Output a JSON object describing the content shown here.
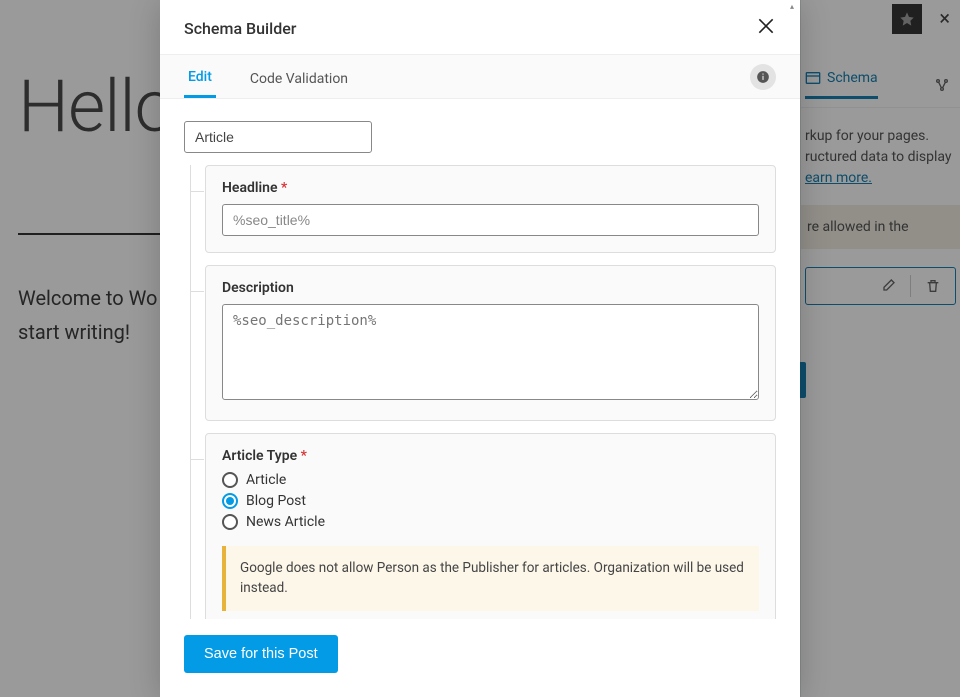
{
  "editor": {
    "title": "Hello world!",
    "body_prefix": "Welcome to Wo",
    "body_suffix": "start writing!",
    "sidebar": {
      "tabs": {
        "schema": "Schema"
      },
      "blurb_line1": "rkup for your pages.",
      "blurb_line2": "ructured data to display",
      "learn_more": "earn more.",
      "note": "re allowed in the"
    }
  },
  "modal": {
    "title": "Schema Builder",
    "tabs": {
      "edit": "Edit",
      "code": "Code Validation"
    },
    "schema_type": "Article",
    "fields": {
      "headline": {
        "label": "Headline",
        "required": true,
        "placeholder": "%seo_title%",
        "value": ""
      },
      "description": {
        "label": "Description",
        "required": false,
        "placeholder": "%seo_description%",
        "value": ""
      },
      "article_type": {
        "label": "Article Type",
        "required": true,
        "options": [
          "Article",
          "Blog Post",
          "News Article"
        ],
        "selected": "Blog Post"
      }
    },
    "notice": "Google does not allow Person as the Publisher for articles. Organization will be used instead.",
    "save_button": "Save for this Post"
  }
}
